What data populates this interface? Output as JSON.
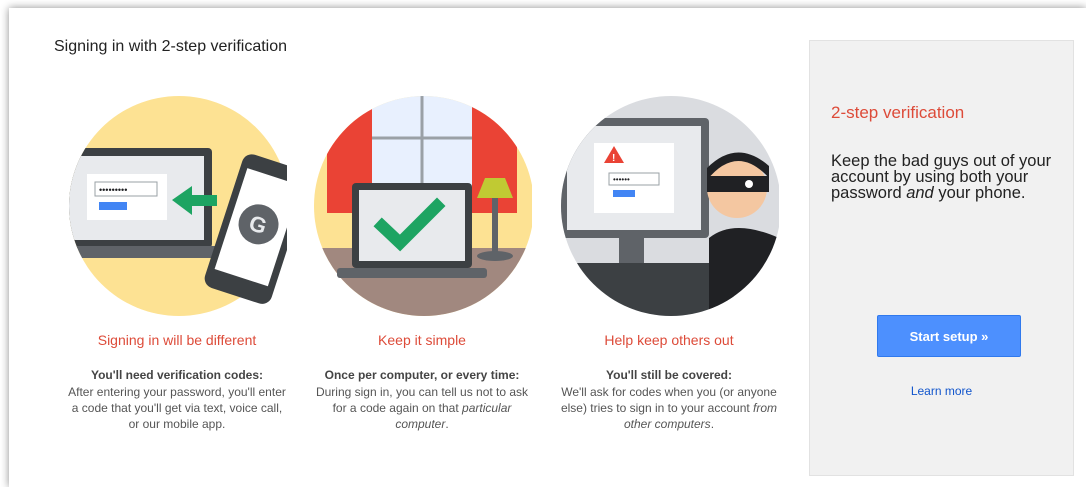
{
  "main": {
    "title": "Signing in with 2-step verification",
    "columns": [
      {
        "title": "Signing in will be different",
        "subtitle": "You'll need verification codes:",
        "description": "After entering your password, you'll enter a code that you'll get via text, voice call, or our mobile app."
      },
      {
        "title": "Keep it simple",
        "subtitle": "Once per computer, or every time:",
        "description_pre": "During sign in, you can tell us not to ask for a code again on that ",
        "description_em": "particular computer",
        "description_post": "."
      },
      {
        "title": "Help keep others out",
        "subtitle": "You'll still be covered:",
        "description_pre": "We'll ask for codes when you (or anyone else) tries to sign in to your account ",
        "description_em": "from other computers",
        "description_post": "."
      }
    ]
  },
  "side_panel": {
    "title": "2-step verification",
    "desc_pre": "Keep the bad guys out of your account by using both your password ",
    "desc_em": "and",
    "desc_post": " your phone.",
    "start_button": "Start setup »",
    "learn_more": "Learn more"
  },
  "illustrations": {
    "password_mask_1": "•••••••••",
    "password_mask_3": "••••••"
  },
  "colors": {
    "accent_red": "#dd4b39",
    "button_blue": "#4d90fe",
    "link_blue": "#1155cc",
    "circle_yellow": "#fde293",
    "check_green": "#1da462"
  },
  "icons": [
    "phone-google-icon",
    "green-arrow-icon",
    "check-icon",
    "warning-icon",
    "thief-icon"
  ]
}
